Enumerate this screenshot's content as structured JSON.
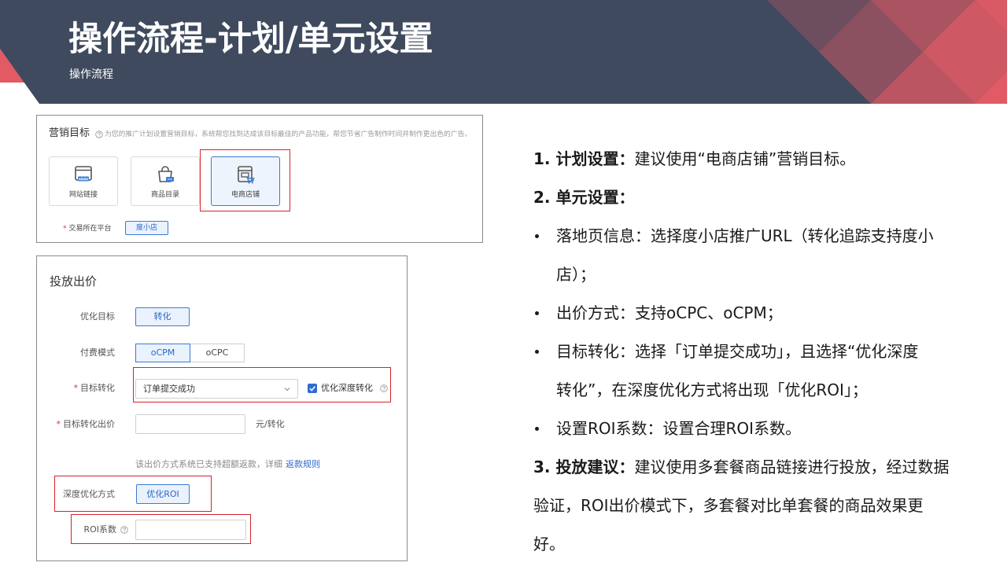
{
  "header": {
    "title": "操作流程-计划/单元设置",
    "subtitle": "操作流程"
  },
  "marketing_panel": {
    "label": "营销目标",
    "help_icon": "question-circle-icon",
    "hint": "为您的推广计划设置营销目标，系统帮您找到达成该目标最佳的产品功能，帮您节省广告制作时间并制作更出色的广告。",
    "goals": [
      {
        "label": "网站链接",
        "icon": "website-link-icon",
        "selected": false
      },
      {
        "label": "商品目录",
        "icon": "shopping-bag-icon",
        "selected": false
      },
      {
        "label": "电商店铺",
        "icon": "store-cart-icon",
        "selected": true
      }
    ],
    "platform": {
      "required_mark": "*",
      "label": "交易所在平台",
      "value": "度小店"
    }
  },
  "bid_panel": {
    "title": "投放出价",
    "optimize_goal": {
      "label": "优化目标",
      "value": "转化"
    },
    "pay_mode": {
      "label": "付费模式",
      "options": [
        {
          "label": "oCPM",
          "selected": true
        },
        {
          "label": "oCPC",
          "selected": false
        }
      ]
    },
    "target_conversion": {
      "required_mark": "*",
      "label": "目标转化",
      "value": "订单提交成功",
      "deep_optimize": {
        "label": "优化深度转化",
        "checked": true
      }
    },
    "target_bid": {
      "required_mark": "*",
      "label": "目标转化出价",
      "value": "",
      "unit": "元/转化"
    },
    "refund_note": {
      "text": "该出价方式系统已支持超额返款，详细",
      "link": "返款规则"
    },
    "deep_mode": {
      "label": "深度优化方式",
      "value": "优化ROI"
    },
    "roi": {
      "label": "ROI系数",
      "value": ""
    }
  },
  "notes": {
    "plan": {
      "label": "1. 计划设置：",
      "text": "建议使用“电商店铺”营销目标。"
    },
    "unit": {
      "label": "2. 单元设置：",
      "bullets": [
        {
          "lines": [
            "落地页信息：选择度小店推广URL（转化追踪支持度小",
            "店）；"
          ]
        },
        {
          "lines": [
            "出价方式：支持oCPC、oCPM；"
          ]
        },
        {
          "lines": [
            "目标转化：选择「订单提交成功」，且选择“优化深度",
            "转化”，在深度优化方式将出现「优化ROI」；"
          ]
        },
        {
          "lines": [
            "设置ROI系数：设置合理ROI系数。"
          ]
        }
      ]
    },
    "advice": {
      "label": "3. 投放建议：",
      "lines": [
        "建议使用多套餐商品链接进行投放，经过数据",
        "验证，ROI出价模式下，多套餐对比单套餐的商品效果更",
        "好。"
      ]
    }
  },
  "colors": {
    "header_bg": "#3f4a5e",
    "accent_red": "#e25a64",
    "highlight_red": "#d4232b",
    "primary_blue": "#3a7bd5"
  }
}
